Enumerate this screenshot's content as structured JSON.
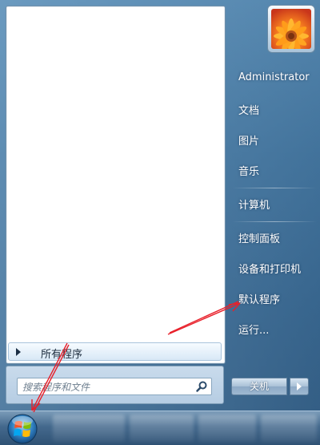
{
  "user": {
    "name": "Administrator"
  },
  "right_menu": {
    "items": [
      {
        "label": "文档"
      },
      {
        "label": "图片"
      },
      {
        "label": "音乐"
      },
      {
        "label": "计算机"
      },
      {
        "label": "控制面板"
      },
      {
        "label": "设备和打印机"
      },
      {
        "label": "默认程序"
      },
      {
        "label": "运行..."
      }
    ]
  },
  "left_menu": {
    "all_programs_label": "所有程序"
  },
  "search": {
    "placeholder": "搜索程序和文件"
  },
  "shutdown": {
    "label": "关机"
  },
  "colors": {
    "annotation_arrow": "#e8202a",
    "menu_text": "#ffffff"
  }
}
